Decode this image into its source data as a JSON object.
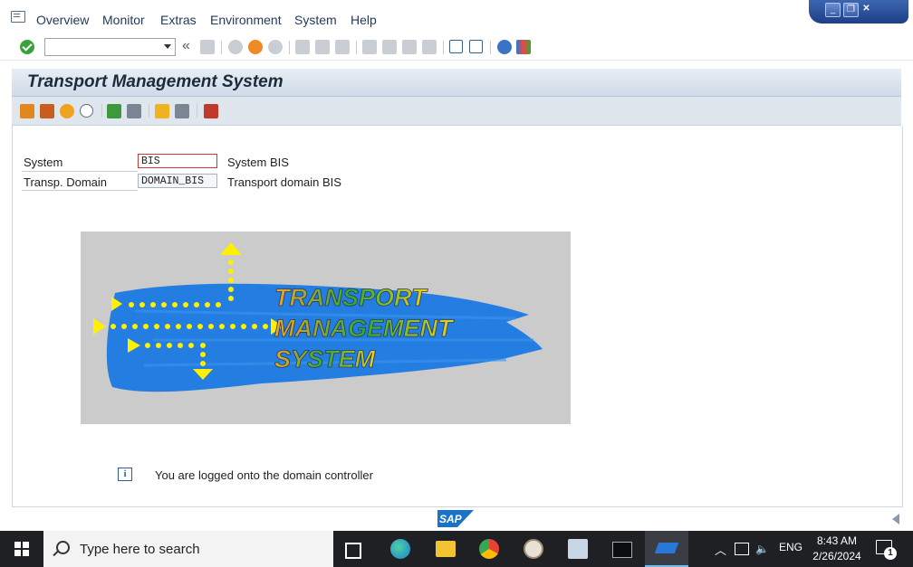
{
  "menu": {
    "items": [
      {
        "label": "Overview"
      },
      {
        "label": "Monitor"
      },
      {
        "label": "Extras"
      },
      {
        "label": "Environment"
      },
      {
        "label": "System"
      },
      {
        "label": "Help"
      }
    ]
  },
  "window_controls": {
    "minimize": "minimize-icon",
    "restore": "restore-icon",
    "close": "close-icon"
  },
  "toolbar": {
    "command_field_value": "",
    "back_glyph": "«"
  },
  "title": "Transport Management System",
  "form": {
    "system_label": "System",
    "system_value": "BIS",
    "system_desc": "System BIS",
    "domain_label": "Transp. Domain",
    "domain_value": "DOMAIN_BIS",
    "domain_desc": "Transport domain BIS"
  },
  "logo": {
    "line1": "TRANSPORT",
    "line2": "MANAGEMENT",
    "line3": "SYSTEM"
  },
  "status": {
    "icon": "i",
    "message": "You are logged onto the domain controller"
  },
  "footer": {
    "sap_logo_text": "SAP"
  },
  "taskbar": {
    "search_placeholder": "Type here to search",
    "language": "ENG",
    "time": "8:43 AM",
    "date": "2/26/2024",
    "notification_count": "1"
  },
  "colors": {
    "accent": "#1f5fbf",
    "title_bg": "#dbe4ee",
    "taskbar": "#1f2024"
  }
}
